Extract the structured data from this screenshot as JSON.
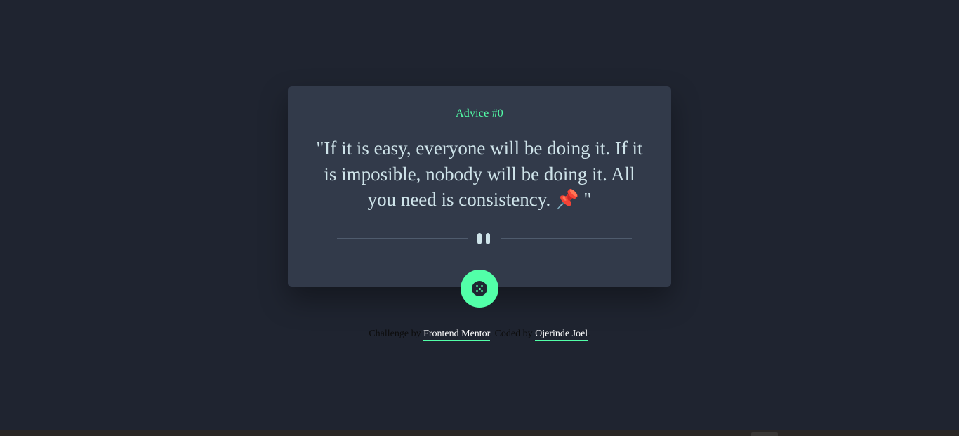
{
  "colors": {
    "background": "#1f2430",
    "card": "#323a4a",
    "accent": "#52ffa8",
    "quote_text": "#cee3e9"
  },
  "card": {
    "label": "Advice #0",
    "quote": "\"If it is easy, everyone will be doing it. If it is imposible, nobody will be doing it. All you need is consistency. 📌 \"",
    "divider_icon": "pause-icon",
    "button_icon": "dice-icon"
  },
  "attribution": {
    "prefix": "Challenge by",
    "challenge_link": "Frontend Mentor",
    "middle": "Coded by",
    "author_link": "Ojerinde Joel"
  }
}
